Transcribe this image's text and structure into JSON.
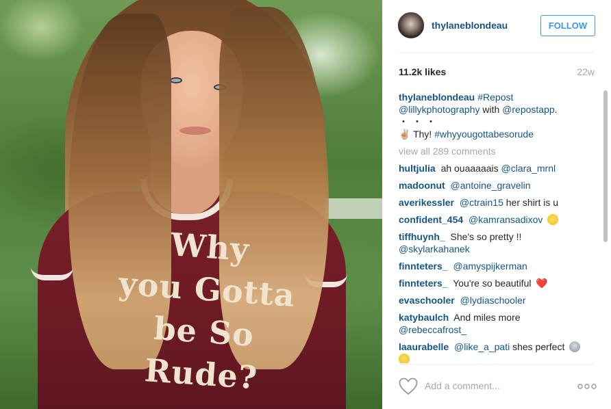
{
  "post": {
    "photo_shirt_lines": [
      "Why",
      "you Gotta",
      "be So",
      "Rude?"
    ]
  },
  "header": {
    "username": "thylaneblondeau",
    "follow_label": "FOLLOW",
    "avatar_icon": "profile-avatar"
  },
  "stats": {
    "likes": "11.2k likes",
    "age": "22w"
  },
  "caption": {
    "user": "thylaneblondeau",
    "tag1": "#Repost",
    "mention1": "@lillykphotography",
    "with": "with",
    "mention2": "@repostapp",
    "period": ".",
    "dots": "・・・",
    "peace": "✌🏼",
    "text": "Thy!",
    "tag2": "#whyyougottabesorude"
  },
  "view_all": "view all 289 comments",
  "comments": [
    {
      "user": "hultjulia",
      "text": "ah ouaaaaais",
      "mention": "@clara_mrnl"
    },
    {
      "user": "madoonut",
      "mention": "@antoine_gravelin"
    },
    {
      "user": "averikessler",
      "mention": "@ctrain15",
      "text": "her shirt is u"
    },
    {
      "user": "confident_454",
      "mention": "@kamransadixov",
      "emoji": "smiley-face-icon"
    },
    {
      "user": "tiffhuynh_",
      "text": "She's so pretty !!",
      "mention": "@skylarkahanek"
    },
    {
      "user": "finnteters_",
      "mention": "@amyspijkerman"
    },
    {
      "user": "finnteters_",
      "text": "You're so beautiful",
      "emoji_char": "❤️"
    },
    {
      "user": "evaschooler",
      "mention": "@lydiaschooler"
    },
    {
      "user": "katybaulch",
      "text": "And miles more",
      "mention": "@rebeccafrost_"
    },
    {
      "user": "laaurabelle",
      "mention": "@like_a_pati",
      "text": "shes perfect",
      "emoji": "alien-icon",
      "emoji2": "heart-eyes-icon"
    }
  ],
  "footer": {
    "add_comment_placeholder": "Add a comment...",
    "heart_icon": "heart-outline-icon",
    "more_icon": "more-options-icon"
  },
  "colors": {
    "link": "#125688",
    "follow": "#3897f0",
    "muted": "#a5a7aa",
    "text": "#262626"
  }
}
